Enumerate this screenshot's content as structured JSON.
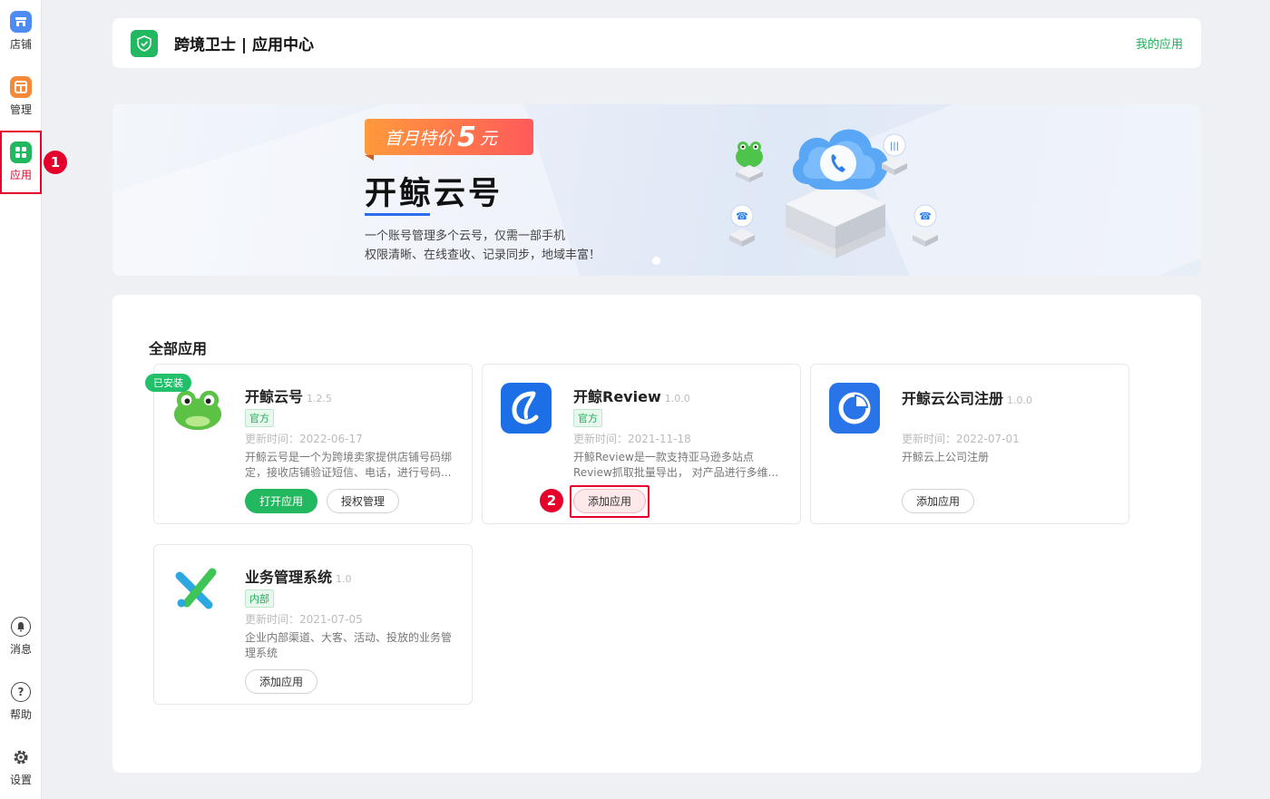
{
  "sidebar": {
    "items": [
      {
        "label": "店铺",
        "icon": "shop-icon",
        "color": "#4d8cf5"
      },
      {
        "label": "管理",
        "icon": "manage-icon",
        "color": "#f5893a"
      },
      {
        "label": "应用",
        "icon": "apps-icon",
        "color": "#22b85f"
      }
    ],
    "bottom": [
      {
        "label": "消息",
        "icon": "bell-icon"
      },
      {
        "label": "帮助",
        "icon": "help-icon"
      },
      {
        "label": "设置",
        "icon": "gear-icon"
      }
    ]
  },
  "steps": {
    "one": "1",
    "two": "2"
  },
  "header": {
    "title": "跨境卫士 | 应用中心",
    "my_apps": "我的应用"
  },
  "banner": {
    "promo_prefix": "首月特价",
    "promo_num": "5",
    "promo_suffix": "元",
    "title": "开鲸云号",
    "line1": "一个账号管理多个云号，仅需一部手机",
    "line2": "权限清晰、在线查收、记录同步，地域丰富！"
  },
  "main": {
    "section_title": "全部应用",
    "apps": [
      {
        "name": "开鲸云号",
        "version": "1.2.5",
        "tag": "官方",
        "updated": "更新时间：2022-06-17",
        "desc": "开鲸云号是一个为跨境卖家提供店铺号码绑定，接收店铺验证短信、电话，进行号码...",
        "installed": "已安装",
        "btn_open": "打开应用",
        "btn_auth": "授权管理"
      },
      {
        "name": "开鲸Review",
        "version": "1.0.0",
        "tag": "官方",
        "updated": "更新时间：2021-11-18",
        "desc": "开鲸Review是一款支持亚马逊多站点Review抓取批量导出， 对产品进行多维...",
        "btn_add": "添加应用"
      },
      {
        "name": "开鲸云公司注册",
        "version": "1.0.0",
        "updated": "更新时间：2022-07-01",
        "desc": "开鲸云上公司注册",
        "btn_add": "添加应用"
      },
      {
        "name": "业务管理系统",
        "version": "1.0",
        "tag": "内部",
        "updated": "更新时间：2021-07-05",
        "desc": "企业内部渠道、大客、活动、投放的业务管理系统",
        "btn_add": "添加应用"
      }
    ]
  }
}
